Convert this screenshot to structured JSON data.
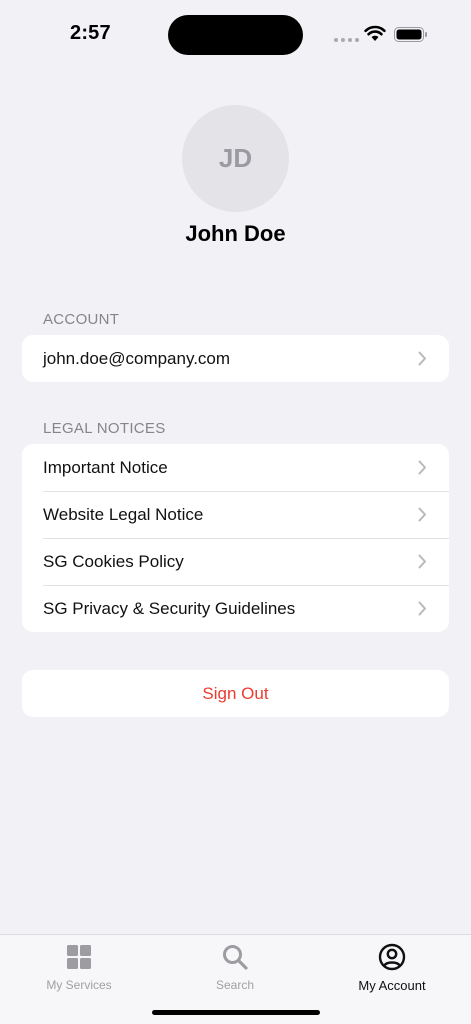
{
  "status_bar": {
    "time": "2:57"
  },
  "profile": {
    "initials": "JD",
    "name": "John Doe"
  },
  "account_section": {
    "header": "ACCOUNT",
    "email": "john.doe@company.com"
  },
  "legal_section": {
    "header": "LEGAL NOTICES",
    "items": [
      {
        "label": "Important Notice"
      },
      {
        "label": "Website Legal Notice"
      },
      {
        "label": "SG Cookies Policy"
      },
      {
        "label": "SG Privacy & Security Guidelines"
      }
    ]
  },
  "sign_out_label": "Sign Out",
  "tab_bar": {
    "tabs": [
      {
        "label": "My Services",
        "icon": "grid-icon",
        "active": false
      },
      {
        "label": "Search",
        "icon": "search-icon",
        "active": false
      },
      {
        "label": "My Account",
        "icon": "account-circle-icon",
        "active": true
      }
    ]
  },
  "colors": {
    "background": "#f2f1f6",
    "destructive": "#ec3b2f",
    "inactive_tab": "#a0a0a5",
    "active_tab": "#111111"
  }
}
